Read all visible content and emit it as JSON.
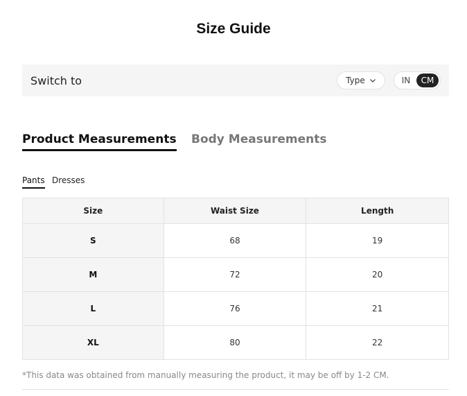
{
  "title": "Size Guide",
  "switch": {
    "label": "Switch to",
    "type_label": "Type",
    "units": [
      "IN",
      "CM"
    ],
    "selected_unit": "CM"
  },
  "tabs": [
    {
      "label": "Product Measurements",
      "active": true
    },
    {
      "label": "Body Measurements",
      "active": false
    }
  ],
  "subtabs": [
    {
      "label": "Pants",
      "active": true
    },
    {
      "label": "Dresses",
      "active": false
    }
  ],
  "table": {
    "headers": [
      "Size",
      "Waist Size",
      "Length"
    ],
    "rows": [
      [
        "S",
        "68",
        "19"
      ],
      [
        "M",
        "72",
        "20"
      ],
      [
        "L",
        "76",
        "21"
      ],
      [
        "XL",
        "80",
        "22"
      ]
    ]
  },
  "footnote": "*This data was obtained from manually measuring the product, it may be off by 1-2 CM.",
  "colors": {
    "accent": "#222222",
    "panel": "#f5f5f5",
    "border": "#e2e2e2"
  }
}
